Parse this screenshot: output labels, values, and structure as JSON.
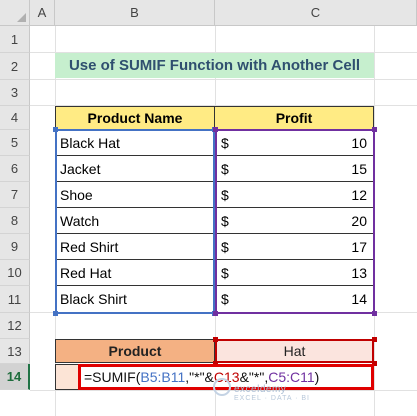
{
  "columns": [
    "A",
    "B",
    "C"
  ],
  "rows": [
    "1",
    "2",
    "3",
    "4",
    "5",
    "6",
    "7",
    "8",
    "9",
    "10",
    "11",
    "12",
    "13",
    "14"
  ],
  "active_row": "14",
  "title": "Use of SUMIF Function with Another Cell",
  "table": {
    "headers": [
      "Product Name",
      "Profit"
    ],
    "rows": [
      {
        "name": "Black Hat",
        "currency": "$",
        "profit": "10"
      },
      {
        "name": "Jacket",
        "currency": "$",
        "profit": "15"
      },
      {
        "name": "Shoe",
        "currency": "$",
        "profit": "12"
      },
      {
        "name": "Watch",
        "currency": "$",
        "profit": "20"
      },
      {
        "name": "Red Shirt",
        "currency": "$",
        "profit": "17"
      },
      {
        "name": "Red Hat",
        "currency": "$",
        "profit": "13"
      },
      {
        "name": "Black Shirt",
        "currency": "$",
        "profit": "14"
      }
    ]
  },
  "criteria": {
    "label": "Product",
    "value": "Hat"
  },
  "formula": {
    "prefix": "=SUMIF(",
    "range": "B5:B11",
    "mid1": ",\"*\"&",
    "criteria_ref": "C13",
    "mid2": "&\"*\",",
    "sum_range": "C5:C11",
    "suffix": ")"
  },
  "watermark": {
    "brand": "exceldemy",
    "tagline": "EXCEL · DATA · BI"
  },
  "colors": {
    "title_bg": "#c6efce",
    "header_bg": "#ffeb84",
    "product_label_bg": "#f4b183",
    "ref_blue": "#4472c4",
    "ref_purple": "#7030a0",
    "ref_red": "#c00000"
  }
}
